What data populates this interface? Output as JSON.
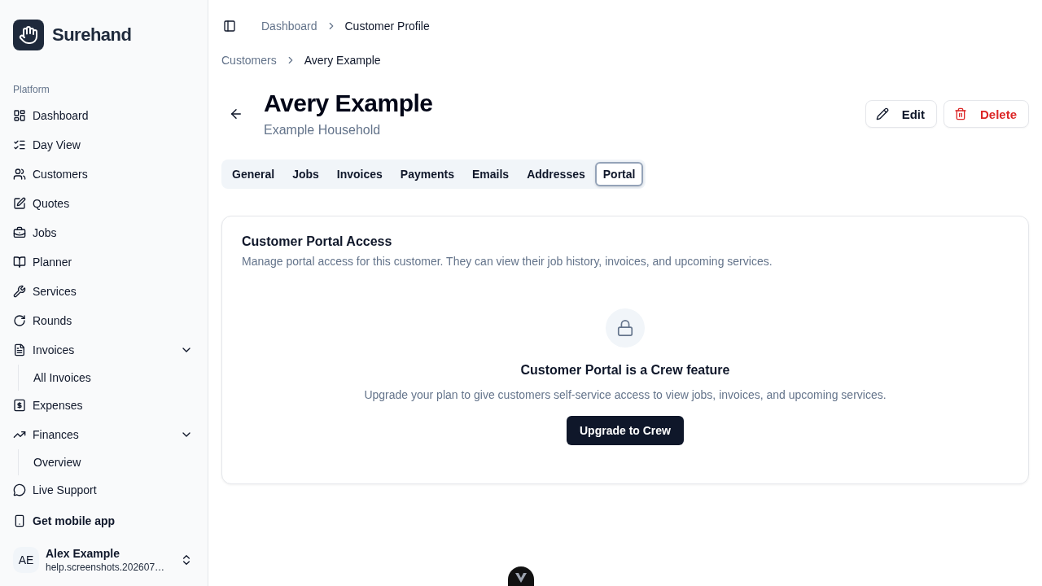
{
  "sidebar": {
    "brand": "Surehand",
    "section_label": "Platform",
    "items": [
      {
        "label": "Dashboard",
        "selected": false
      },
      {
        "label": "Day View",
        "selected": false
      },
      {
        "label": "Customers",
        "selected": false
      },
      {
        "label": "Quotes",
        "selected": false
      },
      {
        "label": "Jobs",
        "selected": false
      },
      {
        "label": "Planner",
        "selected": false
      },
      {
        "label": "Services",
        "selected": false
      },
      {
        "label": "Rounds",
        "selected": false
      },
      {
        "label": "Invoices",
        "selected": false,
        "expanded": true,
        "children": [
          {
            "label": "All Invoices",
            "selected": false
          }
        ]
      },
      {
        "label": "Expenses",
        "selected": false
      },
      {
        "label": "Finances",
        "selected": false,
        "expanded": true,
        "children": [
          {
            "label": "Overview",
            "selected": false
          }
        ]
      },
      {
        "label": "Live Support",
        "selected": false
      }
    ],
    "mobile_app_link": "Get mobile app",
    "user": {
      "initials": "AE",
      "name": "Alex Example",
      "email": "help.screenshots.202607…"
    }
  },
  "header": {
    "breadcrumbs": [
      {
        "label": "Dashboard"
      },
      {
        "label": "Customer Profile"
      }
    ]
  },
  "page": {
    "breadcrumbs": [
      {
        "label": "Customers"
      },
      {
        "label": "Avery Example"
      }
    ],
    "title": "Avery Example",
    "subtitle": "Example Household",
    "actions": [
      {
        "kind": "edit",
        "label": "Edit"
      },
      {
        "kind": "delete",
        "label": "Delete"
      }
    ]
  },
  "tabs": [
    {
      "label": "General",
      "selected": false
    },
    {
      "label": "Jobs",
      "selected": false
    },
    {
      "label": "Invoices",
      "selected": false
    },
    {
      "label": "Payments",
      "selected": false
    },
    {
      "label": "Emails",
      "selected": false
    },
    {
      "label": "Addresses",
      "selected": false
    },
    {
      "label": "Portal",
      "selected": true
    }
  ],
  "portal_card": {
    "title": "Customer Portal Access",
    "description": "Manage portal access for this customer. They can view their job history, invoices, and upcoming services.",
    "locked_heading": "Customer Portal is a Crew feature",
    "locked_text": "Upgrade your plan to give customers self-service access to view jobs, invoices, and upcoming services.",
    "upgrade_button": "Upgrade to Crew"
  }
}
